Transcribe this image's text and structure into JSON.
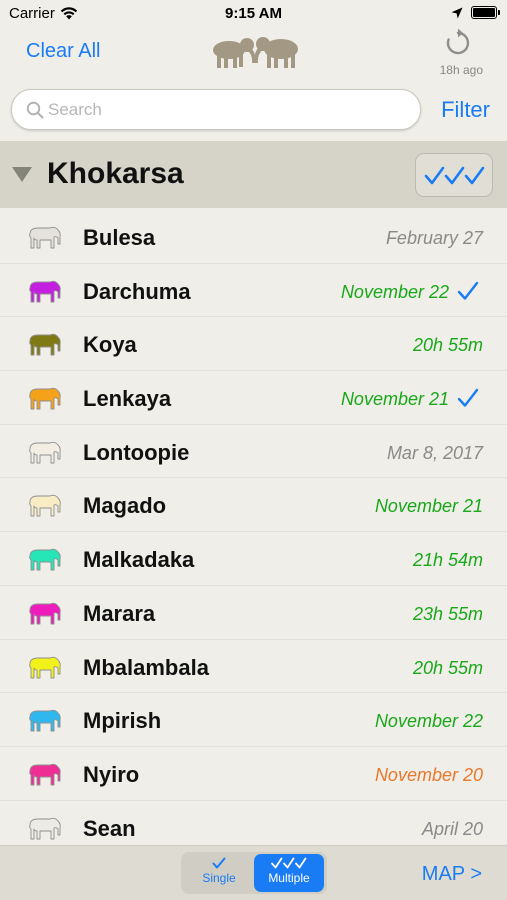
{
  "status_bar": {
    "carrier": "Carrier",
    "time": "9:15 AM"
  },
  "nav": {
    "clear_all": "Clear All",
    "refresh_age": "18h ago",
    "logo_icon": "two-elephants-logo",
    "refresh_icon": "refresh-icon"
  },
  "search": {
    "placeholder": "Search",
    "value": "",
    "filter": "Filter"
  },
  "section": {
    "title": "Khokarsa",
    "check_icon": "triple-check-icon",
    "accent": "#1a7cf5"
  },
  "colors": {
    "green": "#1aa81a",
    "grey": "#8a8a8a",
    "orange": "#e8792d",
    "blue": "#1a7cf5"
  },
  "elephants": [
    {
      "name": "Bulesa",
      "date": "February 27",
      "status": "grey",
      "icon_color": "#e4e2da",
      "checked": false
    },
    {
      "name": "Darchuma",
      "date": "November 22",
      "status": "green",
      "icon_color": "#c41fe0",
      "checked": true
    },
    {
      "name": "Koya",
      "date": "20h 55m",
      "status": "green",
      "icon_color": "#7f7a14",
      "checked": false
    },
    {
      "name": "Lenkaya",
      "date": "November 21",
      "status": "green",
      "icon_color": "#f5a21b",
      "checked": true
    },
    {
      "name": "Lontoopie",
      "date": "Mar 8, 2017",
      "status": "grey",
      "icon_color": "#f2eee4",
      "checked": false
    },
    {
      "name": "Magado",
      "date": "November 21",
      "status": "green",
      "icon_color": "#f7ecc4",
      "checked": false
    },
    {
      "name": "Malkadaka",
      "date": "21h 54m",
      "status": "green",
      "icon_color": "#26e6b8",
      "checked": false
    },
    {
      "name": "Marara",
      "date": "23h 55m",
      "status": "green",
      "icon_color": "#ee1bbd",
      "checked": false
    },
    {
      "name": "Mbalambala",
      "date": "20h 55m",
      "status": "green",
      "icon_color": "#f2f21a",
      "checked": false
    },
    {
      "name": "Mpirish",
      "date": "November 22",
      "status": "green",
      "icon_color": "#2fb7ee",
      "checked": false
    },
    {
      "name": "Nyiro",
      "date": "November 20",
      "status": "orange",
      "icon_color": "#ee2e95",
      "checked": false
    },
    {
      "name": "Sean",
      "date": "April 20",
      "status": "grey",
      "icon_color": "#ecebe6",
      "checked": false
    }
  ],
  "bottom": {
    "single": "Single",
    "multiple": "Multiple",
    "map": "MAP >",
    "selected": "Multiple"
  }
}
